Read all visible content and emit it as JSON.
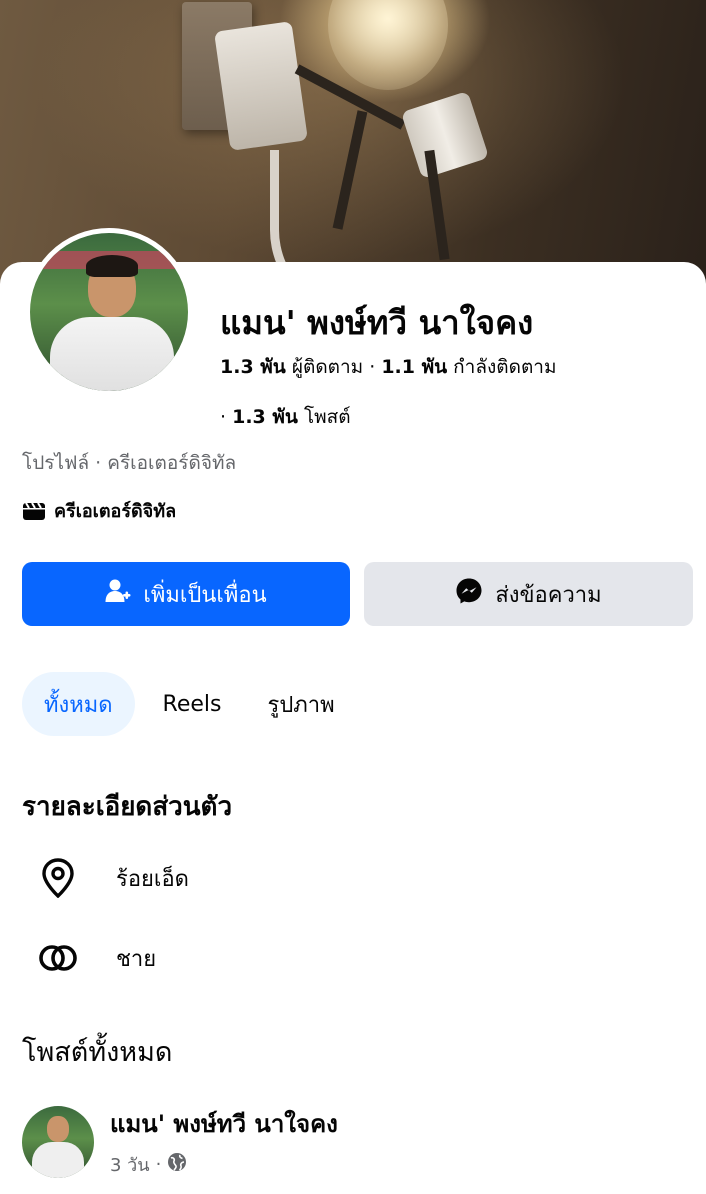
{
  "profile": {
    "name": "แมน' พงษ์ทวี นาใจคง",
    "followers_count": "1.3 พัน",
    "followers_label": "ผู้ติดตาม",
    "following_count": "1.1 พัน",
    "following_label": "กำลังติดตาม",
    "posts_count": "1.3 พัน",
    "posts_label": "โพสต์",
    "sep": "·",
    "subtitle": "โปรไฟล์ · ครีเอเตอร์ดิจิทัล",
    "category": "ครีเอเตอร์ดิจิทัล"
  },
  "actions": {
    "add_friend_label": "เพิ่มเป็นเพื่อน",
    "message_label": "ส่งข้อความ"
  },
  "tabs": [
    {
      "label": "ทั้งหมด",
      "active": true
    },
    {
      "label": "Reels",
      "active": false
    },
    {
      "label": "รูปภาพ",
      "active": false
    }
  ],
  "details": {
    "title": "รายละเอียดส่วนตัว",
    "items": [
      {
        "icon": "location-pin-icon",
        "text": "ร้อยเอ็ด"
      },
      {
        "icon": "gender-icon",
        "text": "ชาย"
      }
    ]
  },
  "posts": {
    "title": "โพสต์ทั้งหมด",
    "first_post": {
      "author": "แมน' พงษ์ทวี นาใจคง",
      "time": "3 วัน",
      "sep": "·",
      "audience_icon": "globe-icon"
    }
  },
  "colors": {
    "primary": "#0866ff",
    "secondary_button": "#e4e6eb",
    "active_tab_bg": "#ebf5ff",
    "muted_text": "#65676b"
  }
}
